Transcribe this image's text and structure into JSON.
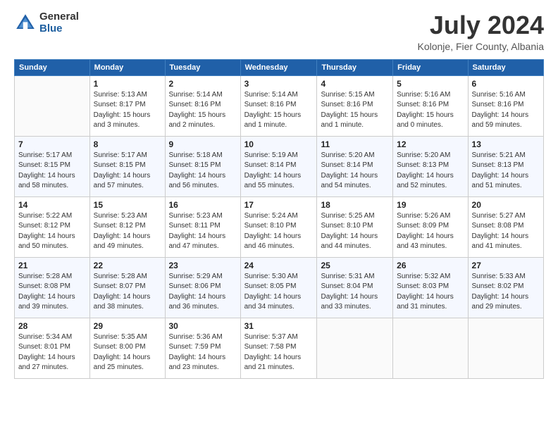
{
  "header": {
    "logo_general": "General",
    "logo_blue": "Blue",
    "month_title": "July 2024",
    "location": "Kolonje, Fier County, Albania"
  },
  "weekdays": [
    "Sunday",
    "Monday",
    "Tuesday",
    "Wednesday",
    "Thursday",
    "Friday",
    "Saturday"
  ],
  "weeks": [
    [
      {
        "day": "",
        "info": ""
      },
      {
        "day": "1",
        "info": "Sunrise: 5:13 AM\nSunset: 8:17 PM\nDaylight: 15 hours\nand 3 minutes."
      },
      {
        "day": "2",
        "info": "Sunrise: 5:14 AM\nSunset: 8:16 PM\nDaylight: 15 hours\nand 2 minutes."
      },
      {
        "day": "3",
        "info": "Sunrise: 5:14 AM\nSunset: 8:16 PM\nDaylight: 15 hours\nand 1 minute."
      },
      {
        "day": "4",
        "info": "Sunrise: 5:15 AM\nSunset: 8:16 PM\nDaylight: 15 hours\nand 1 minute."
      },
      {
        "day": "5",
        "info": "Sunrise: 5:16 AM\nSunset: 8:16 PM\nDaylight: 15 hours\nand 0 minutes."
      },
      {
        "day": "6",
        "info": "Sunrise: 5:16 AM\nSunset: 8:16 PM\nDaylight: 14 hours\nand 59 minutes."
      }
    ],
    [
      {
        "day": "7",
        "info": "Sunrise: 5:17 AM\nSunset: 8:15 PM\nDaylight: 14 hours\nand 58 minutes."
      },
      {
        "day": "8",
        "info": "Sunrise: 5:17 AM\nSunset: 8:15 PM\nDaylight: 14 hours\nand 57 minutes."
      },
      {
        "day": "9",
        "info": "Sunrise: 5:18 AM\nSunset: 8:15 PM\nDaylight: 14 hours\nand 56 minutes."
      },
      {
        "day": "10",
        "info": "Sunrise: 5:19 AM\nSunset: 8:14 PM\nDaylight: 14 hours\nand 55 minutes."
      },
      {
        "day": "11",
        "info": "Sunrise: 5:20 AM\nSunset: 8:14 PM\nDaylight: 14 hours\nand 54 minutes."
      },
      {
        "day": "12",
        "info": "Sunrise: 5:20 AM\nSunset: 8:13 PM\nDaylight: 14 hours\nand 52 minutes."
      },
      {
        "day": "13",
        "info": "Sunrise: 5:21 AM\nSunset: 8:13 PM\nDaylight: 14 hours\nand 51 minutes."
      }
    ],
    [
      {
        "day": "14",
        "info": "Sunrise: 5:22 AM\nSunset: 8:12 PM\nDaylight: 14 hours\nand 50 minutes."
      },
      {
        "day": "15",
        "info": "Sunrise: 5:23 AM\nSunset: 8:12 PM\nDaylight: 14 hours\nand 49 minutes."
      },
      {
        "day": "16",
        "info": "Sunrise: 5:23 AM\nSunset: 8:11 PM\nDaylight: 14 hours\nand 47 minutes."
      },
      {
        "day": "17",
        "info": "Sunrise: 5:24 AM\nSunset: 8:10 PM\nDaylight: 14 hours\nand 46 minutes."
      },
      {
        "day": "18",
        "info": "Sunrise: 5:25 AM\nSunset: 8:10 PM\nDaylight: 14 hours\nand 44 minutes."
      },
      {
        "day": "19",
        "info": "Sunrise: 5:26 AM\nSunset: 8:09 PM\nDaylight: 14 hours\nand 43 minutes."
      },
      {
        "day": "20",
        "info": "Sunrise: 5:27 AM\nSunset: 8:08 PM\nDaylight: 14 hours\nand 41 minutes."
      }
    ],
    [
      {
        "day": "21",
        "info": "Sunrise: 5:28 AM\nSunset: 8:08 PM\nDaylight: 14 hours\nand 39 minutes."
      },
      {
        "day": "22",
        "info": "Sunrise: 5:28 AM\nSunset: 8:07 PM\nDaylight: 14 hours\nand 38 minutes."
      },
      {
        "day": "23",
        "info": "Sunrise: 5:29 AM\nSunset: 8:06 PM\nDaylight: 14 hours\nand 36 minutes."
      },
      {
        "day": "24",
        "info": "Sunrise: 5:30 AM\nSunset: 8:05 PM\nDaylight: 14 hours\nand 34 minutes."
      },
      {
        "day": "25",
        "info": "Sunrise: 5:31 AM\nSunset: 8:04 PM\nDaylight: 14 hours\nand 33 minutes."
      },
      {
        "day": "26",
        "info": "Sunrise: 5:32 AM\nSunset: 8:03 PM\nDaylight: 14 hours\nand 31 minutes."
      },
      {
        "day": "27",
        "info": "Sunrise: 5:33 AM\nSunset: 8:02 PM\nDaylight: 14 hours\nand 29 minutes."
      }
    ],
    [
      {
        "day": "28",
        "info": "Sunrise: 5:34 AM\nSunset: 8:01 PM\nDaylight: 14 hours\nand 27 minutes."
      },
      {
        "day": "29",
        "info": "Sunrise: 5:35 AM\nSunset: 8:00 PM\nDaylight: 14 hours\nand 25 minutes."
      },
      {
        "day": "30",
        "info": "Sunrise: 5:36 AM\nSunset: 7:59 PM\nDaylight: 14 hours\nand 23 minutes."
      },
      {
        "day": "31",
        "info": "Sunrise: 5:37 AM\nSunset: 7:58 PM\nDaylight: 14 hours\nand 21 minutes."
      },
      {
        "day": "",
        "info": ""
      },
      {
        "day": "",
        "info": ""
      },
      {
        "day": "",
        "info": ""
      }
    ]
  ]
}
